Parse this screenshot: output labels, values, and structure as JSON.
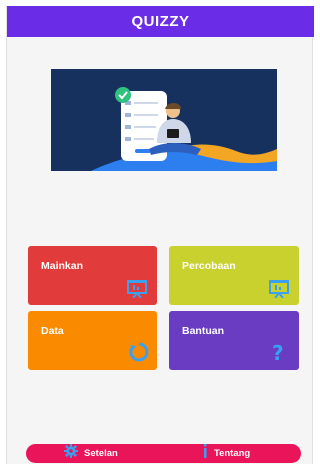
{
  "app": {
    "title": "QUIZZY"
  },
  "menu": [
    {
      "label": "Mainkan",
      "color": "#e23b3c",
      "icon": "presentation-board-icon"
    },
    {
      "label": "Percobaan",
      "color": "#c8d12e",
      "icon": "presentation-board-icon"
    },
    {
      "label": "Data",
      "color": "#fa8a00",
      "icon": "refresh-circle-icon"
    },
    {
      "label": "Bantuan",
      "color": "#6a3cc1",
      "icon": "question-mark-icon"
    }
  ],
  "bottom_nav": {
    "settings_label": "Setelan",
    "settings_icon": "gear-icon",
    "about_label": "Tentang",
    "about_icon": "info-icon"
  },
  "colors": {
    "appbar": "#6a2ce6",
    "bottom_bar": "#ea145a",
    "icon_blue": "#3aa0f0"
  }
}
